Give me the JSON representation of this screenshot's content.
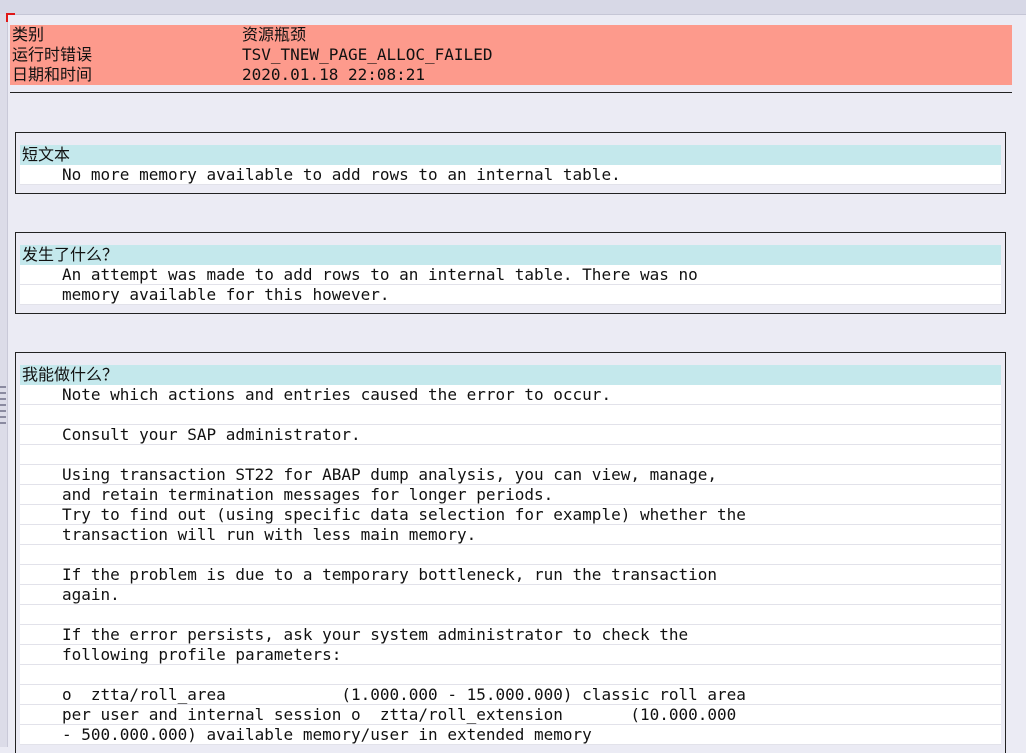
{
  "header": {
    "rows": [
      {
        "label": "类别",
        "value": "资源瓶颈"
      },
      {
        "label": "运行时错误",
        "value": "TSV_TNEW_PAGE_ALLOC_FAILED"
      },
      {
        "label": "日期和时间",
        "value": "2020.01.18 22:08:21"
      }
    ]
  },
  "sections": [
    {
      "title": "短文本",
      "lines": [
        "No more memory available to add rows to an internal table."
      ]
    },
    {
      "title": "发生了什么？",
      "lines": [
        "An attempt was made to add rows to an internal table. There was no",
        "memory available for this however."
      ]
    },
    {
      "title": "我能做什么？",
      "lines": [
        "Note which actions and entries caused the error to occur.",
        "",
        "Consult your SAP administrator.",
        "",
        "Using transaction ST22 for ABAP dump analysis, you can view, manage,",
        "and retain termination messages for longer periods.",
        "Try to find out (using specific data selection for example) whether the",
        "transaction will run with less main memory.",
        "",
        "If the problem is due to a temporary bottleneck, run the transaction",
        "again.",
        "",
        "If the error persists, ask your system administrator to check the",
        "following profile parameters:",
        "",
        "o  ztta/roll_area            (1.000.000 - 15.000.000) classic roll area",
        "per user and internal session o  ztta/roll_extension       (10.000.000",
        "- 500.000.000) available memory/user in extended memory"
      ]
    }
  ]
}
